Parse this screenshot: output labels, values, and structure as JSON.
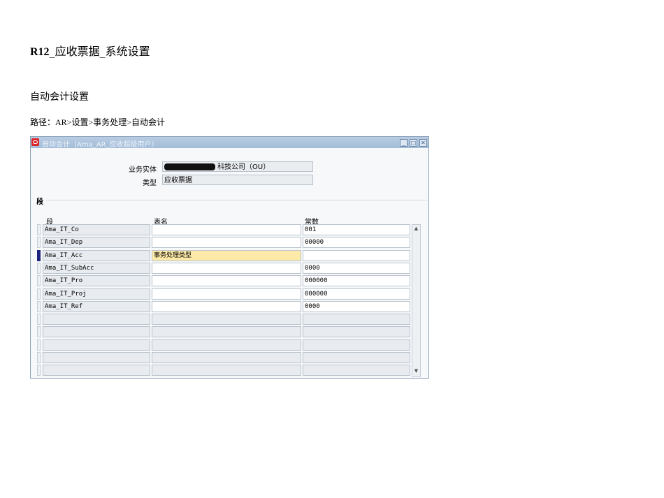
{
  "doc": {
    "title_bold": "R12",
    "title_rest": "_应收票据_系统设置",
    "subtitle": "自动会计设置",
    "path": "路径：AR>设置>事务处理>自动会计"
  },
  "window": {
    "title": "自动会计（Ama_AR_应收超级用户）",
    "controls": {
      "minimize": "_",
      "maximize": "□",
      "close": "✕"
    },
    "fields": {
      "ou_label": "业务实体",
      "ou_value": "科技公司（OU）",
      "type_label": "类型",
      "type_value": "应收票据"
    },
    "section": "段",
    "columns": {
      "segment": "段",
      "table": "表名",
      "constant": "常数"
    },
    "rows": [
      {
        "segment": "Ama_IT_Co",
        "table": "",
        "constant": "001"
      },
      {
        "segment": "Ama_IT_Dep",
        "table": "",
        "constant": "00000"
      },
      {
        "segment": "Ama_IT_Acc",
        "table": "事务处理类型",
        "constant": "",
        "current": true
      },
      {
        "segment": "Ama_IT_SubAcc",
        "table": "",
        "constant": "0000"
      },
      {
        "segment": "Ama_IT_Pro",
        "table": "",
        "constant": "000000"
      },
      {
        "segment": "Ama_IT_Proj",
        "table": "",
        "constant": "000000"
      },
      {
        "segment": "Ama_IT_Ref",
        "table": "",
        "constant": "0000"
      }
    ],
    "empty_rows": 5,
    "scroll": {
      "up": "▲",
      "down": "▼"
    }
  }
}
